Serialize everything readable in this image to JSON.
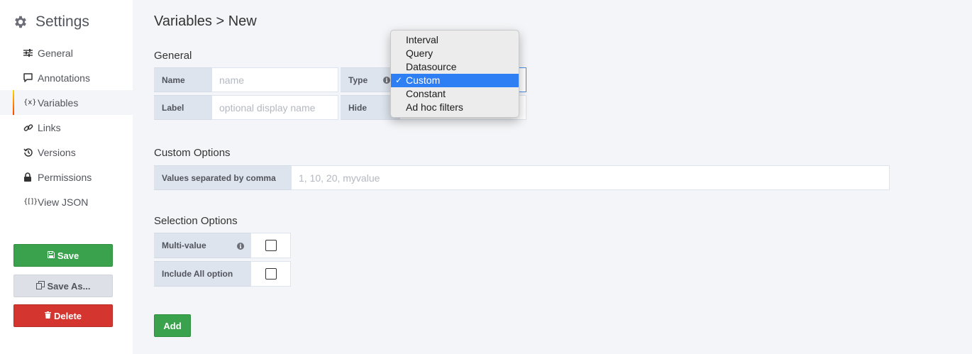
{
  "sidebar": {
    "title": "Settings",
    "items": [
      {
        "label": "General",
        "icon": "sliders-icon"
      },
      {
        "label": "Annotations",
        "icon": "comment-icon"
      },
      {
        "label": "Variables",
        "icon": "variable-icon",
        "active": true
      },
      {
        "label": "Links",
        "icon": "link-icon"
      },
      {
        "label": "Versions",
        "icon": "history-icon"
      },
      {
        "label": "Permissions",
        "icon": "lock-icon"
      },
      {
        "label": "View JSON",
        "icon": "json-icon"
      }
    ],
    "save_label": "Save",
    "save_as_label": "Save As...",
    "delete_label": "Delete"
  },
  "main": {
    "title": "Variables > New",
    "general": {
      "heading": "General",
      "name_label": "Name",
      "name_placeholder": "name",
      "type_label": "Type",
      "label_label": "Label",
      "label_placeholder": "optional display name",
      "hide_label": "Hide"
    },
    "type_dropdown": {
      "options": [
        "Interval",
        "Query",
        "Datasource",
        "Custom",
        "Constant",
        "Ad hoc filters"
      ],
      "selected": "Custom",
      "check": "✓"
    },
    "custom_options": {
      "heading": "Custom Options",
      "values_label": "Values separated by comma",
      "values_placeholder": "1, 10, 20, myvalue"
    },
    "selection_options": {
      "heading": "Selection Options",
      "multi_value_label": "Multi-value",
      "multi_value_checked": false,
      "include_all_label": "Include All option",
      "include_all_checked": false
    },
    "add_label": "Add"
  },
  "colors": {
    "accent_green": "#3aa24c",
    "danger_red": "#d4352f",
    "selection_blue": "#2f7ff4"
  }
}
